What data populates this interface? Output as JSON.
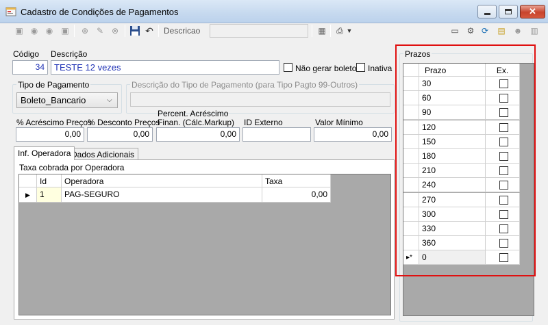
{
  "window": {
    "title": "Cadastro de Condições de Pagamentos"
  },
  "toolbar": {
    "search_label": "Descricao",
    "search_value": ""
  },
  "form": {
    "codigo_label": "Código",
    "codigo_value": "34",
    "descricao_label": "Descrição",
    "descricao_value": "TESTE 12 vezes",
    "nao_gerar_boleto_label": "Não gerar boleto",
    "inativa_label": "Inativa",
    "tipo_pagamento_label": "Tipo de Pagamento",
    "tipo_pagamento_value": "Boleto_Bancario",
    "descricao_tipo_label": "Descrição do Tipo de Pagamento (para Tipo Pagto 99-Outros)",
    "descricao_tipo_value": "",
    "acrescimo_label": "% Acréscimo Preços",
    "acrescimo_value": "0,00",
    "desconto_label": "% Desconto Preços",
    "desconto_value": "0,00",
    "percent_fin_label_1": "Percent. Acréscimo",
    "percent_fin_label_2": "Finan. (Cálc.Markup)",
    "percent_fin_value": "0,00",
    "id_externo_label": "ID Externo",
    "id_externo_value": "",
    "valor_minimo_label": "Valor Mínimo",
    "valor_minimo_value": "0,00"
  },
  "tabs": [
    {
      "label": "Inf. Operadora"
    },
    {
      "label": "Dados Adicionais"
    }
  ],
  "operadora": {
    "section_label": "Taxa cobrada por Operadora",
    "columns": [
      "Id",
      "Operadora",
      "Taxa"
    ],
    "rows": [
      {
        "id": "1",
        "operadora": "PAG-SEGURO",
        "taxa": "0,00"
      }
    ]
  },
  "prazos": {
    "group_label": "Prazos",
    "columns": [
      "Prazo",
      "Ex."
    ],
    "rows": [
      "30",
      "60",
      "90",
      "120",
      "150",
      "180",
      "210",
      "240",
      "270",
      "300",
      "330",
      "360"
    ],
    "new_row_value": "0",
    "new_row_marker": "▸*"
  }
}
